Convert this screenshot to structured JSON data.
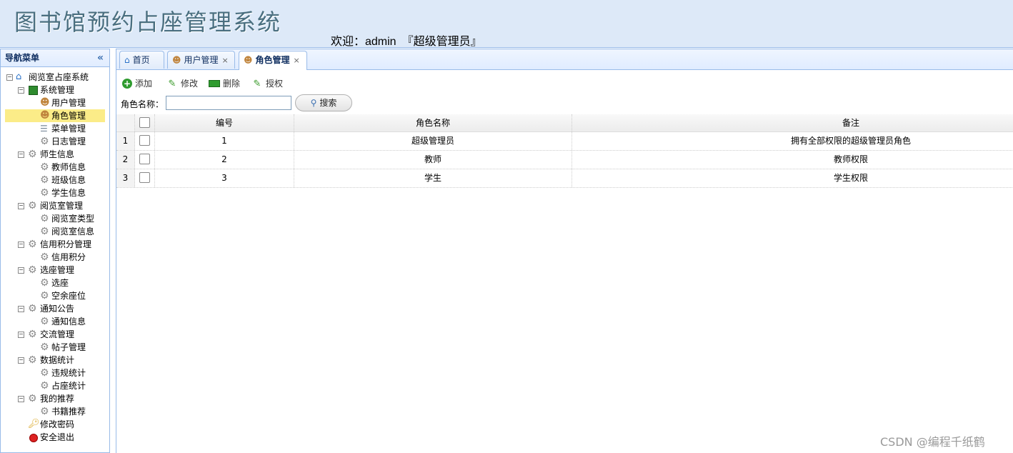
{
  "header": {
    "app_title": "图书馆预约占座管理系统",
    "welcome": "欢迎：admin",
    "role": "『超级管理员』"
  },
  "sidebar": {
    "title": "导航菜单",
    "collapse_icon": "double-chevron-left-icon",
    "tree": [
      {
        "label": "阅览室占座系统",
        "icon": "home-icon"
      },
      {
        "label": "系统管理",
        "icon": "folder-icon"
      },
      {
        "label": "用户管理",
        "icon": "user-icon"
      },
      {
        "label": "角色管理",
        "icon": "role-icon",
        "selected": true
      },
      {
        "label": "菜单管理",
        "icon": "menu-icon"
      },
      {
        "label": "日志管理",
        "icon": "gear-icon"
      },
      {
        "label": "师生信息",
        "icon": "gear-icon"
      },
      {
        "label": "教师信息",
        "icon": "gear-icon"
      },
      {
        "label": "班级信息",
        "icon": "gear-icon"
      },
      {
        "label": "学生信息",
        "icon": "gear-icon"
      },
      {
        "label": "阅览室管理",
        "icon": "gear-icon"
      },
      {
        "label": "阅览室类型",
        "icon": "gear-icon"
      },
      {
        "label": "阅览室信息",
        "icon": "gear-icon"
      },
      {
        "label": "信用积分管理",
        "icon": "gear-icon"
      },
      {
        "label": "信用积分",
        "icon": "gear-icon"
      },
      {
        "label": "选座管理",
        "icon": "gear-icon"
      },
      {
        "label": "选座",
        "icon": "gear-icon"
      },
      {
        "label": "空余座位",
        "icon": "gear-icon"
      },
      {
        "label": "通知公告",
        "icon": "gear-icon"
      },
      {
        "label": "通知信息",
        "icon": "gear-icon"
      },
      {
        "label": "交流管理",
        "icon": "gear-icon"
      },
      {
        "label": "帖子管理",
        "icon": "gear-icon"
      },
      {
        "label": "数据统计",
        "icon": "gear-icon"
      },
      {
        "label": "违规统计",
        "icon": "gear-icon"
      },
      {
        "label": "占座统计",
        "icon": "gear-icon"
      },
      {
        "label": "我的推荐",
        "icon": "gear-icon"
      },
      {
        "label": "书籍推荐",
        "icon": "gear-icon"
      },
      {
        "label": "修改密码",
        "icon": "key-icon"
      },
      {
        "label": "安全退出",
        "icon": "exit-icon"
      }
    ]
  },
  "tabs": [
    {
      "label": "首页",
      "icon": "home-icon"
    },
    {
      "label": "用户管理",
      "icon": "user-icon",
      "close": "×"
    },
    {
      "label": "角色管理",
      "icon": "role-icon",
      "close": "×",
      "active": true
    }
  ],
  "toolbar": {
    "add": "添加",
    "edit": "修改",
    "delete": "删除",
    "authorize": "授权"
  },
  "search": {
    "label": "角色名称：",
    "value": "",
    "button": "搜索"
  },
  "grid": {
    "columns": [
      "编号",
      "角色名称",
      "备注"
    ],
    "rows": [
      {
        "num": "1",
        "id": "1",
        "name": "超级管理员",
        "remark": "拥有全部权限的超级管理员角色"
      },
      {
        "num": "2",
        "id": "2",
        "name": "教师",
        "remark": "教师权限"
      },
      {
        "num": "3",
        "id": "3",
        "name": "学生",
        "remark": "学生权限"
      }
    ]
  },
  "watermark": "CSDN @编程千纸鹤",
  "colors": {
    "header_bg": "#dde9f8",
    "border": "#99bbe8",
    "selected_bg": "#fbec88",
    "title_color": "#4a6f80"
  }
}
